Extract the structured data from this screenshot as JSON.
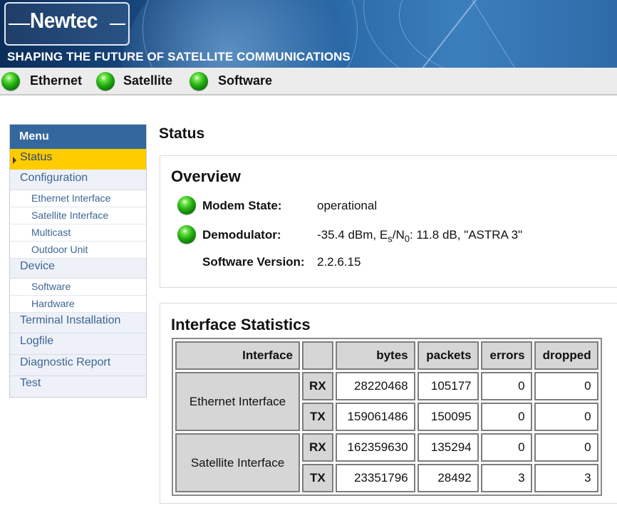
{
  "header": {
    "logo_text": "Newtec",
    "tagline": "SHAPING THE FUTURE OF SATELLITE COMMUNICATIONS"
  },
  "status_indicators": [
    {
      "label": "Ethernet",
      "state": "green"
    },
    {
      "label": "Satellite",
      "state": "green"
    },
    {
      "label": "Software",
      "state": "green"
    }
  ],
  "sidebar": {
    "title": "Menu",
    "items": [
      {
        "label": "Status",
        "level": "main",
        "active": true
      },
      {
        "label": "Configuration",
        "level": "main"
      },
      {
        "label": "Ethernet Interface",
        "level": "sub"
      },
      {
        "label": "Satellite Interface",
        "level": "sub"
      },
      {
        "label": "Multicast",
        "level": "sub"
      },
      {
        "label": "Outdoor Unit",
        "level": "sub"
      },
      {
        "label": "Device",
        "level": "main"
      },
      {
        "label": "Software",
        "level": "sub"
      },
      {
        "label": "Hardware",
        "level": "sub"
      },
      {
        "label": "Terminal Installation",
        "level": "main"
      },
      {
        "label": "Logfile",
        "level": "main"
      },
      {
        "label": "Diagnostic Report",
        "level": "main"
      },
      {
        "label": "Test",
        "level": "main"
      }
    ]
  },
  "page": {
    "title": "Status"
  },
  "overview": {
    "title": "Overview",
    "rows": [
      {
        "label": "Modem State:",
        "value": "operational",
        "led": "green"
      },
      {
        "label": "Demodulator:",
        "value_prefix": "-35.4 dBm, E",
        "value_sub1": "s",
        "value_mid": "/N",
        "value_sub2": "0",
        "value_suffix": ": 11.8 dB, \"ASTRA 3\"",
        "led": "green"
      },
      {
        "label": "Software Version:",
        "value": "2.2.6.15"
      }
    ]
  },
  "stats": {
    "title": "Interface Statistics",
    "columns": [
      "Interface",
      "",
      "bytes",
      "packets",
      "errors",
      "dropped"
    ],
    "interfaces": [
      {
        "name": "Ethernet Interface",
        "rows": [
          {
            "dir": "RX",
            "bytes": "28220468",
            "packets": "105177",
            "errors": "0",
            "dropped": "0"
          },
          {
            "dir": "TX",
            "bytes": "159061486",
            "packets": "150095",
            "errors": "0",
            "dropped": "0"
          }
        ]
      },
      {
        "name": "Satellite Interface",
        "rows": [
          {
            "dir": "RX",
            "bytes": "162359630",
            "packets": "135294",
            "errors": "0",
            "dropped": "0"
          },
          {
            "dir": "TX",
            "bytes": "23351796",
            "packets": "28492",
            "errors": "3",
            "dropped": "3"
          }
        ]
      }
    ]
  }
}
